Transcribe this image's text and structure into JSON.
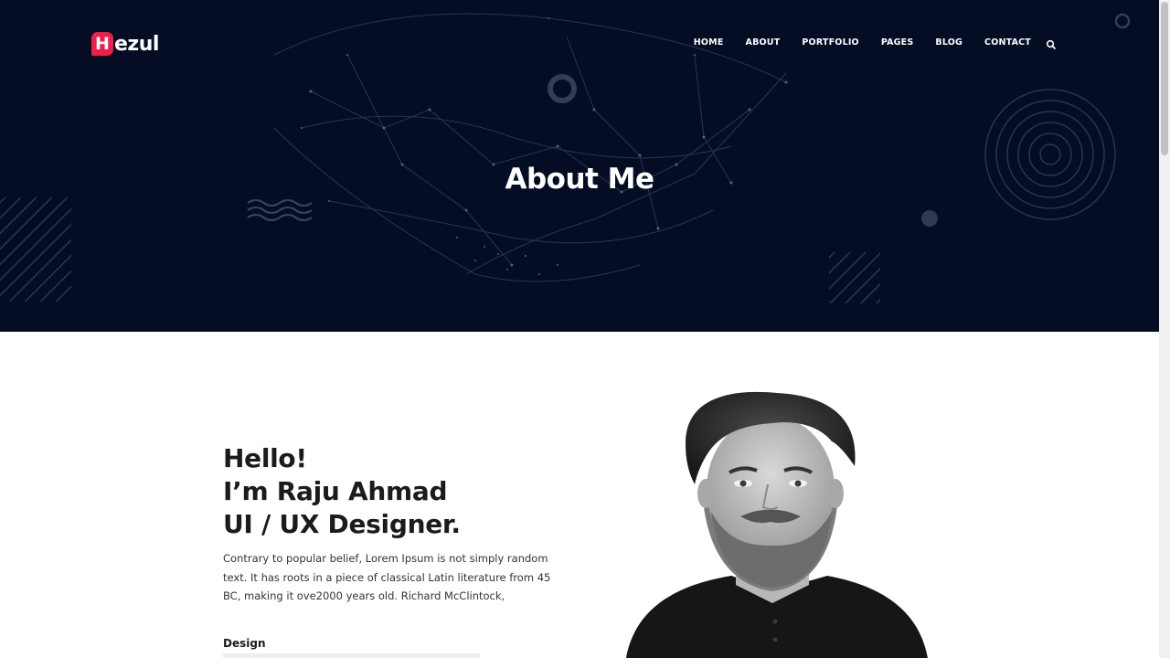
{
  "logo": {
    "mark": "H",
    "text": "ezul"
  },
  "nav": {
    "items": [
      "HOME",
      "ABOUT",
      "PORTFOLIO",
      "PAGES",
      "BLOG",
      "CONTACT"
    ],
    "search_icon": "search-icon"
  },
  "hero": {
    "title": "About Me"
  },
  "about": {
    "heading_lines": [
      "Hello!",
      "I’m Raju Ahmad",
      "UI / UX Designer."
    ],
    "body": "Contrary to popular belief, Lorem Ipsum is not simply random text. It has roots in a piece of classical Latin literature from 45 BC, making it ove2000 years old. Richard McClintock,"
  },
  "skills": [
    {
      "label": "Design"
    }
  ],
  "colors": {
    "hero_background": "#050d24",
    "brand_accent": "#ef1f4a",
    "text_dark": "#1b1b1b"
  }
}
